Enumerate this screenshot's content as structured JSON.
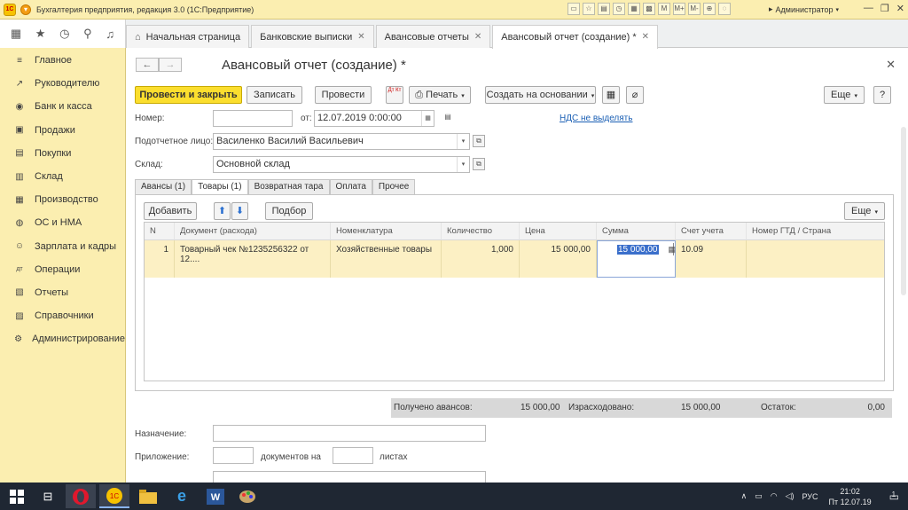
{
  "window": {
    "title": "Бухгалтерия предприятия, редакция 3.0  (1С:Предприятие)",
    "user": "Администратор",
    "logo": "1С"
  },
  "tabs": [
    {
      "label": "Начальная страница"
    },
    {
      "label": "Банковские выписки"
    },
    {
      "label": "Авансовые отчеты"
    },
    {
      "label": "Авансовый отчет (создание) *"
    }
  ],
  "sidebar": {
    "items": [
      {
        "label": "Главное",
        "icon": "≡"
      },
      {
        "label": "Руководителю",
        "icon": "↗"
      },
      {
        "label": "Банк и касса",
        "icon": "◉"
      },
      {
        "label": "Продажи",
        "icon": "▣"
      },
      {
        "label": "Покупки",
        "icon": "▤"
      },
      {
        "label": "Склад",
        "icon": "▥"
      },
      {
        "label": "Производство",
        "icon": "▦"
      },
      {
        "label": "ОС и НМА",
        "icon": "◍"
      },
      {
        "label": "Зарплата и кадры",
        "icon": "☺"
      },
      {
        "label": "Операции",
        "icon": "дт"
      },
      {
        "label": "Отчеты",
        "icon": "▧"
      },
      {
        "label": "Справочники",
        "icon": "▨"
      },
      {
        "label": "Администрирование",
        "icon": "⚙"
      }
    ]
  },
  "form": {
    "title": "Авансовый отчет (создание) *",
    "toolbar": {
      "post_close": "Провести и закрыть",
      "save": "Записать",
      "post": "Провести",
      "dt_kt": "Дт Кт",
      "print": "Печать",
      "create_based": "Создать на основании",
      "more": "Еще",
      "help": "?"
    },
    "number_label": "Номер:",
    "number_value": "",
    "date_label": "от:",
    "date_value": "12.07.2019  0:00:00",
    "vat_link": "НДС не выделять",
    "person_label": "Подотчетное лицо:",
    "person_value": "Василенко Василий Васильевич",
    "warehouse_label": "Склад:",
    "warehouse_value": "Основной склад",
    "tabs": [
      "Авансы (1)",
      "Товары (1)",
      "Возвратная тара",
      "Оплата",
      "Прочее"
    ],
    "table_toolbar": {
      "add": "Добавить",
      "pick": "Подбор",
      "more": "Еще"
    },
    "columns": [
      "N",
      "Документ (расхода)",
      "Номенклатура",
      "Количество",
      "Цена",
      "Сумма",
      "Счет учета",
      "Номер ГТД / Страна"
    ],
    "rows": [
      {
        "n": "1",
        "doc": "Товарный чек №1235256322 от 12....",
        "item": "Хозяйственные товары",
        "qty": "1,000",
        "price": "15 000,00",
        "sum": "15 000,00",
        "account": "10.09",
        "gtd": ""
      }
    ],
    "totals": {
      "received_label": "Получено авансов:",
      "received_value": "15 000,00",
      "spent_label": "Израсходовано:",
      "spent_value": "15 000,00",
      "rest_label": "Остаток:",
      "rest_value": "0,00"
    },
    "purpose_label": "Назначение:",
    "purpose_value": "",
    "attach_label": "Приложение:",
    "attach_docs_label": "документов на",
    "attach_sheets_label": "листах"
  },
  "taskbar": {
    "lang": "РУС",
    "time": "21:02",
    "date": "Пт 12.07.19",
    "notif": "1"
  }
}
